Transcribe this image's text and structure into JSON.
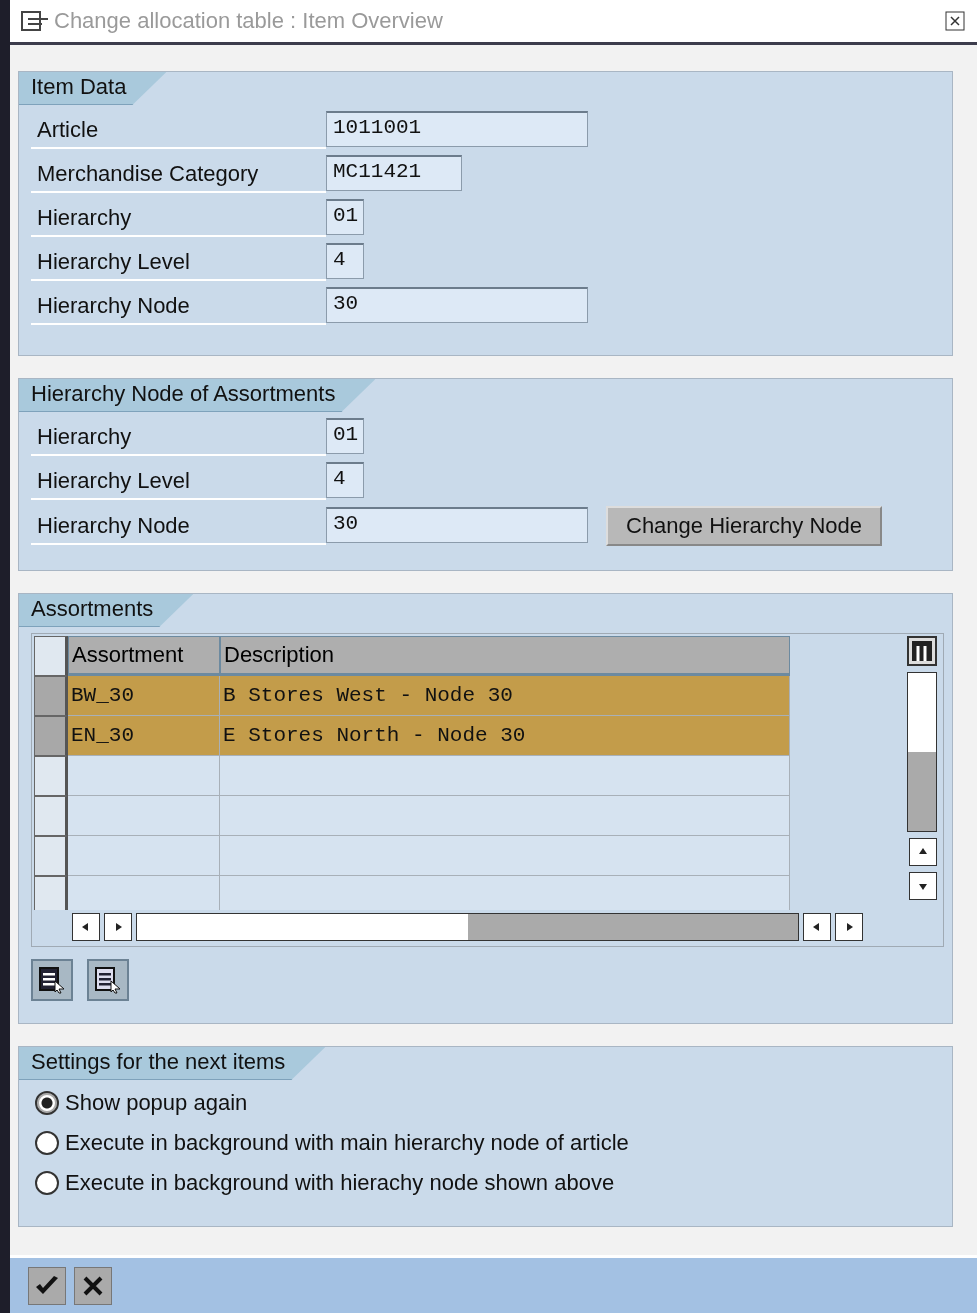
{
  "window": {
    "title": "Change allocation table : Item Overview"
  },
  "item_data": {
    "title": "Item Data",
    "fields": [
      {
        "label": "Article",
        "value": "1011001"
      },
      {
        "label": "Merchandise Category",
        "value": "MC11421"
      },
      {
        "label": "Hierarchy",
        "value": "01"
      },
      {
        "label": "Hierarchy Level",
        "value": "4"
      },
      {
        "label": "Hierarchy Node",
        "value": "30"
      }
    ]
  },
  "assortment_node": {
    "title": "Hierarchy Node of Assortments",
    "fields": [
      {
        "label": "Hierarchy",
        "value": "01"
      },
      {
        "label": "Hierarchy Level",
        "value": "4"
      },
      {
        "label": "Hierarchy Node",
        "value": "30"
      }
    ],
    "button": "Change Hierarchy Node"
  },
  "assortments": {
    "title": "Assortments",
    "columns": [
      "Assortment",
      "Description"
    ],
    "rows": [
      {
        "assortment": "BW_30",
        "description": "B Stores West - Node 30",
        "selected": true
      },
      {
        "assortment": "EN_30",
        "description": "E Stores North - Node 30",
        "selected": true
      }
    ]
  },
  "settings": {
    "title": "Settings for the next items",
    "options": [
      {
        "label": "Show popup again",
        "selected": true
      },
      {
        "label": "Execute in background with main hierarchy node of article",
        "selected": false
      },
      {
        "label": "Execute in background with hierachy node shown above",
        "selected": false
      }
    ]
  }
}
